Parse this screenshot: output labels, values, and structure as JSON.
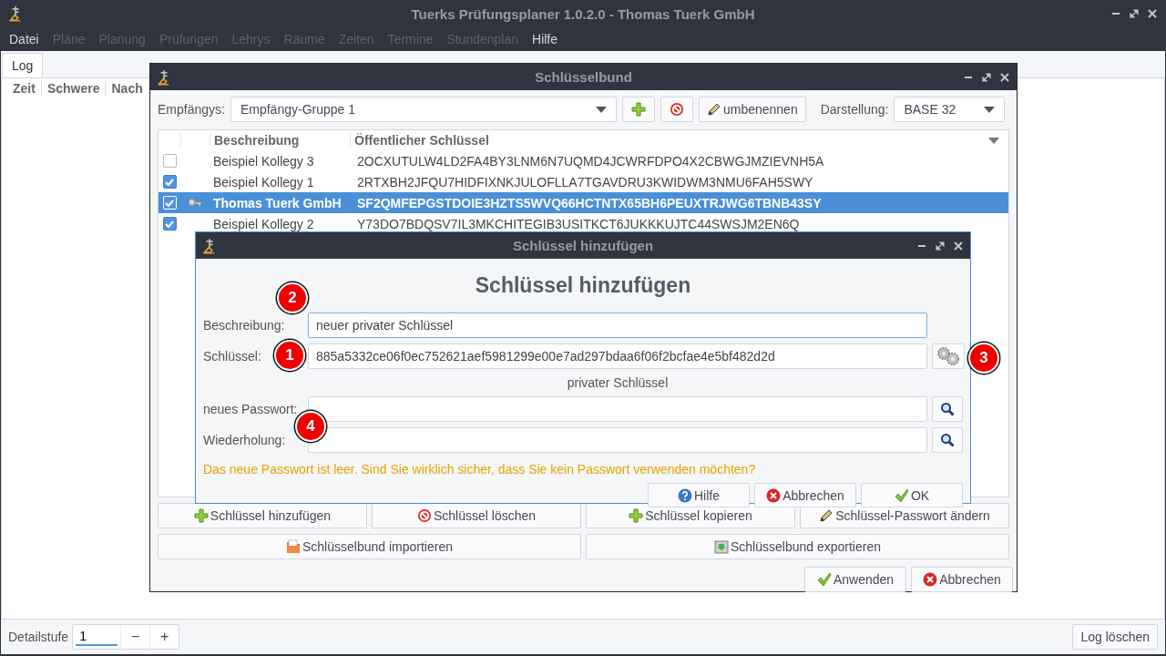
{
  "window": {
    "title": "Tuerks Prüfungsplaner 1.0.2.0 - Thomas Tuerk GmbH"
  },
  "menu": [
    {
      "label": "Datei",
      "disabled": false
    },
    {
      "label": "Pläne",
      "disabled": true
    },
    {
      "label": "Planung",
      "disabled": true
    },
    {
      "label": "Prüfungen",
      "disabled": true
    },
    {
      "label": "Lehrys",
      "disabled": true
    },
    {
      "label": "Räume",
      "disabled": true
    },
    {
      "label": "Zeiten",
      "disabled": true
    },
    {
      "label": "Termine",
      "disabled": true
    },
    {
      "label": "Stundenplan",
      "disabled": true
    },
    {
      "label": "Hilfe",
      "disabled": false
    }
  ],
  "tabs": [
    {
      "label": "Log",
      "selected": true
    }
  ],
  "log": {
    "columns": [
      "Zeit",
      "Schwere",
      "Nach"
    ]
  },
  "bottom_bar": {
    "label": "Detailstufe",
    "value": "1",
    "decrement": "−",
    "increment": "+",
    "clear_button": "Log löschen"
  },
  "keyring": {
    "title": "Schlüsselbund",
    "recipients_label": "Empfängys:",
    "recipients_value": "Empfängy-Gruppe 1",
    "rename_button": "umbenennen",
    "display_label": "Darstellung:",
    "display_value": "BASE 32",
    "columns": [
      "Beschreibung",
      "Öffentlicher Schlüssel"
    ],
    "rows": [
      {
        "checked": false,
        "selected": false,
        "own_key": false,
        "description": "Beispiel Kollegy 3",
        "key": "2OCXUTULW4LD2FA4BY3LNM6N7UQMD4JCWRFDPO4X2CBWGJMZIEVNH5A"
      },
      {
        "checked": true,
        "selected": false,
        "own_key": false,
        "description": "Beispiel Kollegy 1",
        "key": "2RTXBH2JFQU7HIDFIXNKJULOFLLA7TGAVDRU3KWIDWM3NMU6FAH5SWY"
      },
      {
        "checked": true,
        "selected": true,
        "own_key": true,
        "description": "Thomas Tuerk GmbH",
        "key": "SF2QMFEPGSTDOIE3HZTS5WVQ66HCTNTX65BH6PEUXTRJWG6TBNB43SY"
      },
      {
        "checked": true,
        "selected": false,
        "own_key": false,
        "description": "Beispiel Kollegy 2",
        "key": "Y73DO7BDQSV7IL3MKCHITEGIB3USITKCT6JUKKKUJTC44SWSJM2EN6Q"
      }
    ],
    "actions": [
      {
        "label": "Schlüssel hinzufügen",
        "kind": "plus"
      },
      {
        "label": "Schlüssel löschen",
        "kind": "stop"
      },
      {
        "label": "Schlüssel kopieren",
        "kind": "plus"
      },
      {
        "label": "Schlüssel-Passwort ändern",
        "kind": "pencil"
      }
    ],
    "transfer_actions": [
      {
        "label": "Schlüsselbund importieren",
        "kind": "folder"
      },
      {
        "label": "Schlüsselbund exportieren",
        "kind": "export"
      }
    ],
    "dialog_buttons": [
      {
        "label": "Anwenden",
        "kind": "check"
      },
      {
        "label": "Abbrechen",
        "kind": "cancel"
      }
    ]
  },
  "add_key_dialog": {
    "title": "Schlüssel hinzufügen",
    "heading": "Schlüssel hinzufügen",
    "fields": [
      {
        "label": "Beschreibung:",
        "value": "neuer privater Schlüssel",
        "focused": true,
        "badge": "2",
        "kind": "text"
      },
      {
        "label": "Schlüssel:",
        "value": "885a5332ce06f0ec752621aef5981299e00e7ad297bdaa6f06f2bcfae4e5bf482d2d",
        "focused": false,
        "badge": "1",
        "kind": "generate",
        "button_badge": "3"
      }
    ],
    "key_type": "privater Schlüssel",
    "password_fields": [
      {
        "label": "neues Passwort:",
        "kind": "reveal"
      },
      {
        "label": "Wiederholung:",
        "kind": "reveal",
        "badge": "4"
      }
    ],
    "warning": "Das neue Passwort ist leer. Sind Sie wirklich sicher, dass Sie kein Passwort verwenden möchten?",
    "buttons": [
      {
        "label": "Hilfe",
        "kind": "help"
      },
      {
        "label": "Abbrechen",
        "kind": "cancel"
      },
      {
        "label": "OK",
        "kind": "check"
      }
    ]
  }
}
